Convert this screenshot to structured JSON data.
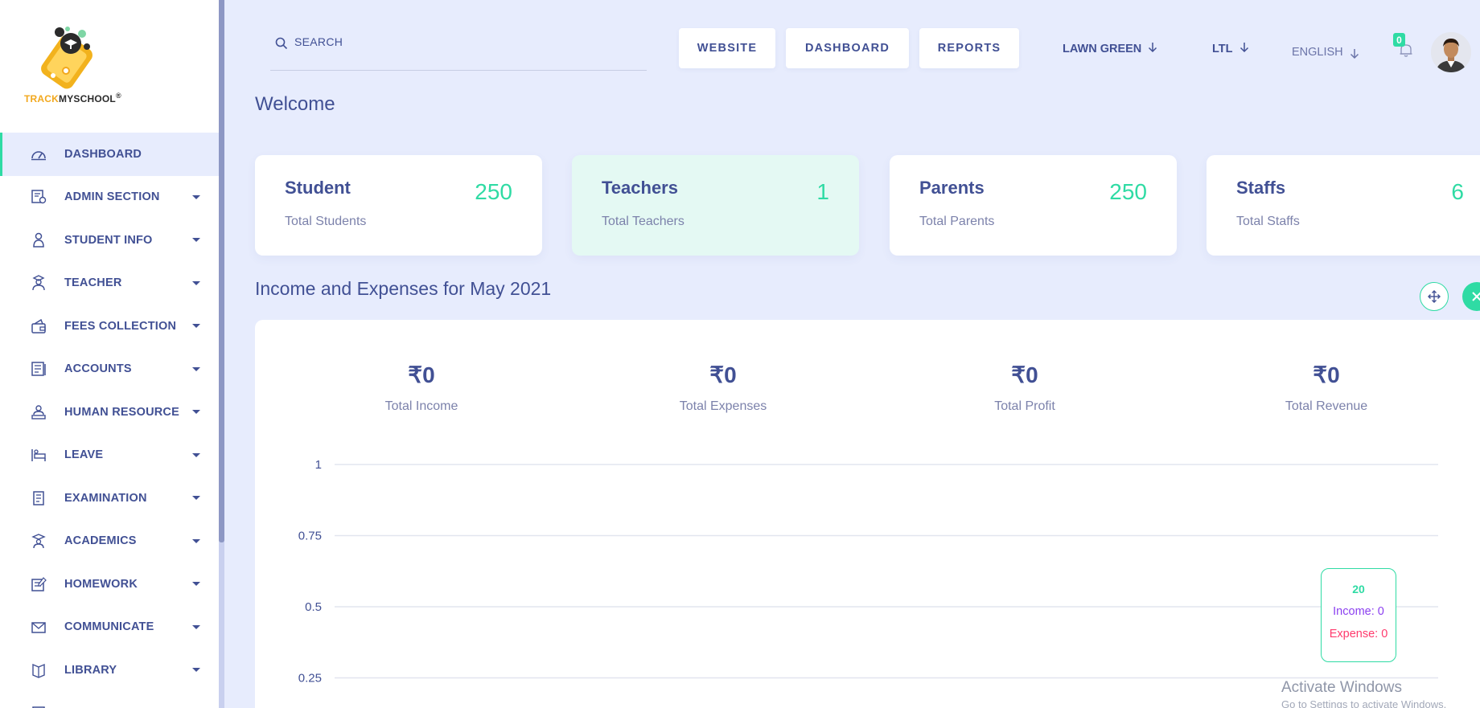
{
  "brand": {
    "logo_text_a": "TRACK",
    "logo_text_b": "MYSCHOOL",
    "logo_mark": "®"
  },
  "sidebar": {
    "items": [
      {
        "label": "Dashboard",
        "icon": "dashboard-icon"
      },
      {
        "label": "Admin Section",
        "icon": "admin-section-icon"
      },
      {
        "label": "Student Info",
        "icon": "student-info-icon"
      },
      {
        "label": "Teacher",
        "icon": "teacher-icon"
      },
      {
        "label": "Fees Collection",
        "icon": "fees-collection-icon"
      },
      {
        "label": "Accounts",
        "icon": "accounts-icon"
      },
      {
        "label": "Human Resource",
        "icon": "human-resource-icon"
      },
      {
        "label": "Leave",
        "icon": "leave-icon"
      },
      {
        "label": "Examination",
        "icon": "examination-icon"
      },
      {
        "label": "Academics",
        "icon": "academics-icon"
      },
      {
        "label": "Homework",
        "icon": "homework-icon"
      },
      {
        "label": "Communicate",
        "icon": "communicate-icon"
      },
      {
        "label": "Library",
        "icon": "library-icon"
      }
    ]
  },
  "topbar": {
    "search_placeholder": "SEARCH",
    "website": "WEBSITE",
    "dashboard": "DASHBOARD",
    "reports": "REPORTS",
    "theme": "LAWN GREEN",
    "direction": "LTL",
    "language": "ENGLISH",
    "notification_count": "0"
  },
  "welcome": "Welcome",
  "stats": [
    {
      "title": "Student",
      "sub": "Total Students",
      "value": "250"
    },
    {
      "title": "Teachers",
      "sub": "Total Teachers",
      "value": "1"
    },
    {
      "title": "Parents",
      "sub": "Total Parents",
      "value": "250"
    },
    {
      "title": "Staffs",
      "sub": "Total Staffs",
      "value": "6"
    }
  ],
  "finance": {
    "title": "Income and Expenses for May 2021",
    "items": [
      {
        "value": "₹0",
        "label": "Total Income"
      },
      {
        "value": "₹0",
        "label": "Total Expenses"
      },
      {
        "value": "₹0",
        "label": "Total Profit"
      },
      {
        "value": "₹0",
        "label": "Total Revenue"
      }
    ]
  },
  "chart_data": {
    "type": "line",
    "y_ticks": [
      "1",
      "0.75",
      "0.5",
      "0.25"
    ],
    "ylim": [
      0,
      1
    ],
    "grid": true,
    "series": [
      {
        "name": "Income",
        "values": [
          0
        ]
      },
      {
        "name": "Expense",
        "values": [
          0
        ]
      }
    ],
    "tooltip": {
      "x": "20",
      "income": "Income: 0",
      "expense": "Expense: 0"
    }
  },
  "colors": {
    "accent": "#2fdba4",
    "text": "#415094",
    "income": "#8b3ff0",
    "expense": "#ff3a6d"
  },
  "watermark": {
    "line1": "Activate Windows",
    "line2": "Go to Settings to activate Windows."
  }
}
